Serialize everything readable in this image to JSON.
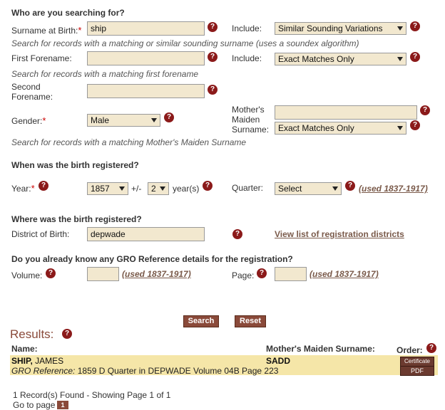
{
  "section1": {
    "heading": "Who are you searching for?",
    "surname_label": "Surname at Birth:",
    "surname_value": "ship",
    "include_label_1": "Include:",
    "include_value_1": "Similar Sounding Variations",
    "surname_hint": "Search for records with a matching or similar sounding surname (uses a soundex algorithm)",
    "forename_label": "First Forename:",
    "forename_value": "",
    "include_label_2": "Include:",
    "include_value_2": "Exact Matches Only",
    "forename_hint": "Search for records with a matching first forename",
    "second_forename_label_1": "Second",
    "second_forename_label_2": "Forename:",
    "second_forename_value": "",
    "gender_label": "Gender:",
    "gender_value": "Male",
    "mmn_label_1": "Mother's",
    "mmn_label_2": "Maiden",
    "mmn_label_3": "Surname:",
    "mmn_value": "",
    "mmn_include_value": "Exact Matches Only",
    "mmn_hint": "Search for records with a matching Mother's Maiden Surname",
    "required_mark": "*",
    "help_glyph": "?"
  },
  "section2": {
    "heading": "When was the birth registered?",
    "year_label": "Year:",
    "year_value": "1857",
    "plusminus_label": "+/-",
    "range_value": "2",
    "years_label": "year(s)",
    "quarter_label": "Quarter:",
    "quarter_value": "Select",
    "quarter_used": "(used 1837-1917)"
  },
  "section3": {
    "heading": "Where was the birth registered?",
    "district_label": "District of Birth:",
    "district_value": "depwade",
    "district_link": "View list of registration districts"
  },
  "section4": {
    "heading": "Do you already know any GRO Reference details for the registration?",
    "volume_label": "Volume:",
    "volume_value": "",
    "volume_used": "(used 1837-1917)",
    "page_label": "Page:",
    "page_value": "",
    "page_used": "(used 1837-1917)"
  },
  "buttons": {
    "search": "Search",
    "reset": "Reset"
  },
  "results": {
    "title": "Results:",
    "col_name": "Name:",
    "col_mmn": "Mother's Maiden Surname:",
    "col_order": "Order:",
    "row": {
      "surname": "SHIP,",
      "forenames": "JAMES",
      "mmn": "SADD",
      "gro_label": "GRO Reference:",
      "gro_detail": "1859  D Quarter in DEPWADE  Volume 04B  Page 223",
      "cert_button": "Certificate",
      "pdf_button": "PDF"
    },
    "summary": "1 Record(s) Found - Showing Page 1 of 1",
    "goto_label": "Go to page",
    "goto_page": "1"
  },
  "colors": {
    "input_bg": "#f2e8cf",
    "help_bg": "#8b1a1a",
    "button_bg": "#8a4a3a",
    "result_band": "#f5e6a8",
    "link": "#7a5a4a"
  }
}
